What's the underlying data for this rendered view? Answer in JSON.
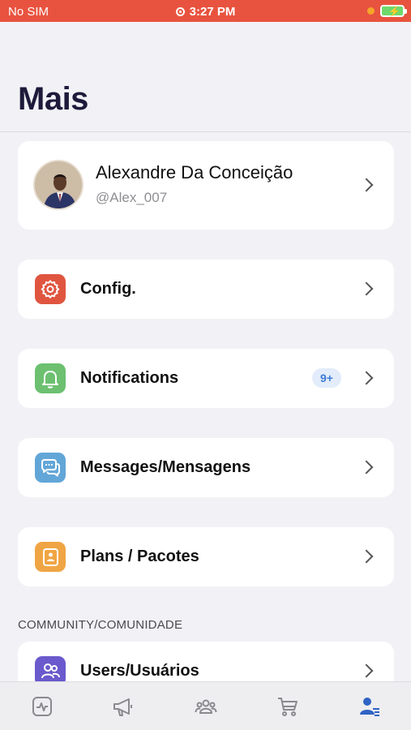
{
  "status_bar": {
    "carrier": "No SIM",
    "time": "3:27 PM"
  },
  "page": {
    "title": "Mais"
  },
  "profile": {
    "name": "Alexandre Da Conceição",
    "handle": "@Alex_007"
  },
  "menu": [
    {
      "label": "Config.",
      "icon": "gear-icon",
      "color": "#e0553f"
    },
    {
      "label": "Notifications",
      "icon": "bell-icon",
      "color": "#6cc070",
      "badge": "9+"
    },
    {
      "label": "Messages/Mensagens",
      "icon": "chat-icon",
      "color": "#62a6d8"
    },
    {
      "label": "Plans / Pacotes",
      "icon": "id-card-icon",
      "color": "#f0a544"
    }
  ],
  "community": {
    "header": "COMMUNITY/COMUNIDADE",
    "items": [
      {
        "label": "Users/Usuários",
        "icon": "users-icon",
        "color": "#6a5acd"
      }
    ]
  },
  "tab_bar": {
    "tabs": [
      {
        "icon": "activity-icon",
        "active": false
      },
      {
        "icon": "megaphone-icon",
        "active": false
      },
      {
        "icon": "group-icon",
        "active": false
      },
      {
        "icon": "cart-icon",
        "active": false
      },
      {
        "icon": "profile-list-icon",
        "active": true
      }
    ],
    "active_color": "#2f63c4",
    "inactive_color": "#8a8a8e"
  }
}
